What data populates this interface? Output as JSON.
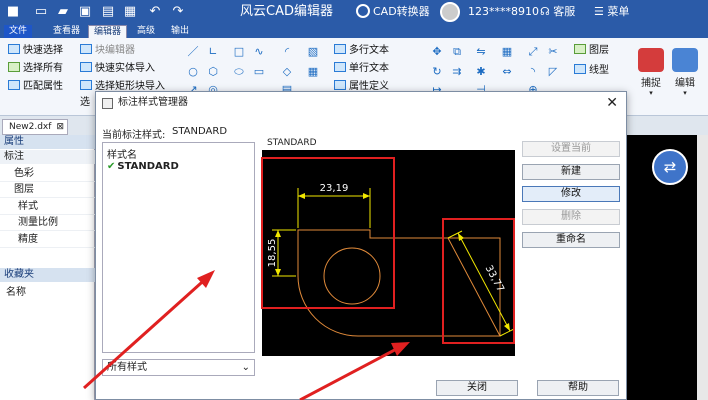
{
  "app": {
    "title": "风云CAD编辑器",
    "convert_label": "CAD转换器",
    "user_label": "123****8910",
    "service_label": "客服",
    "menu_label": "菜单"
  },
  "tabs": [
    "文件",
    "查看器",
    "编辑器",
    "高级",
    "输出"
  ],
  "ribbon": {
    "left_items": [
      "快速选择",
      "选择所有",
      "匹配属性"
    ],
    "mid_items": [
      "块编辑器",
      "快速实体导入",
      "选择矩形块导入"
    ],
    "text_items": [
      "多行文本",
      "单行文本",
      "属性定义"
    ],
    "layer_items": [
      "图层",
      "线型"
    ],
    "big_buttons": [
      "捕捉",
      "编辑"
    ],
    "partial_label": "选"
  },
  "document_tab": "New2.dxf",
  "left_panel": {
    "props_header": "属性",
    "section": "标注",
    "props": [
      "色彩",
      "图层",
      "样式",
      "测量比例",
      "精度"
    ],
    "fav_header": "收藏夹",
    "fav_item": "名称"
  },
  "dialog": {
    "title": "标注样式管理器",
    "current_label": "当前标注样式:",
    "current_value": "STANDARD",
    "list_header": "样式名",
    "styles": [
      "STANDARD"
    ],
    "filter_value": "所有样式",
    "preview_label": "STANDARD",
    "buttons": {
      "set_current": "设置当前",
      "new": "新建",
      "modify": "修改",
      "delete": "删除",
      "rename": "重命名",
      "close": "关闭",
      "help": "帮助"
    },
    "dims": {
      "horizontal": "23,19",
      "vertical": "18,55",
      "aligned": "33,77"
    }
  },
  "colors": {
    "title_bar": "#2b5ba8",
    "annotation": "#e02020",
    "dim_line": "#f2e800",
    "geometry": "#e08a3a"
  }
}
